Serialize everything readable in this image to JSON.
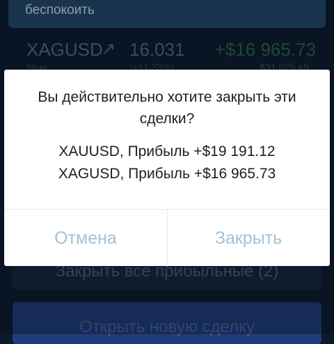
{
  "background": {
    "banner_text": "беспокоить",
    "trade": {
      "symbol": "XAGUSD",
      "arrow": "↗",
      "price": "16.031",
      "profit": "+$16 965.73",
      "name": "Silver",
      "change": "(+11.23%)",
      "volume": "$31 025 ×5"
    },
    "close_all_label": "Закрыть все прибыльные (2)",
    "open_trade_label": "Открыть новую сделку"
  },
  "dialog": {
    "title": "Вы действительно хотите закрыть эти сделки?",
    "lines": [
      "XAUUSD, Прибыль +$19 191.12",
      "XAGUSD, Прибыль +$16 965.73"
    ],
    "cancel_label": "Отмена",
    "confirm_label": "Закрыть"
  },
  "colors": {
    "dialog_button_text": "#9fc2d8",
    "background": "#0c1a2b",
    "profit_green": "#2c6a3c"
  }
}
